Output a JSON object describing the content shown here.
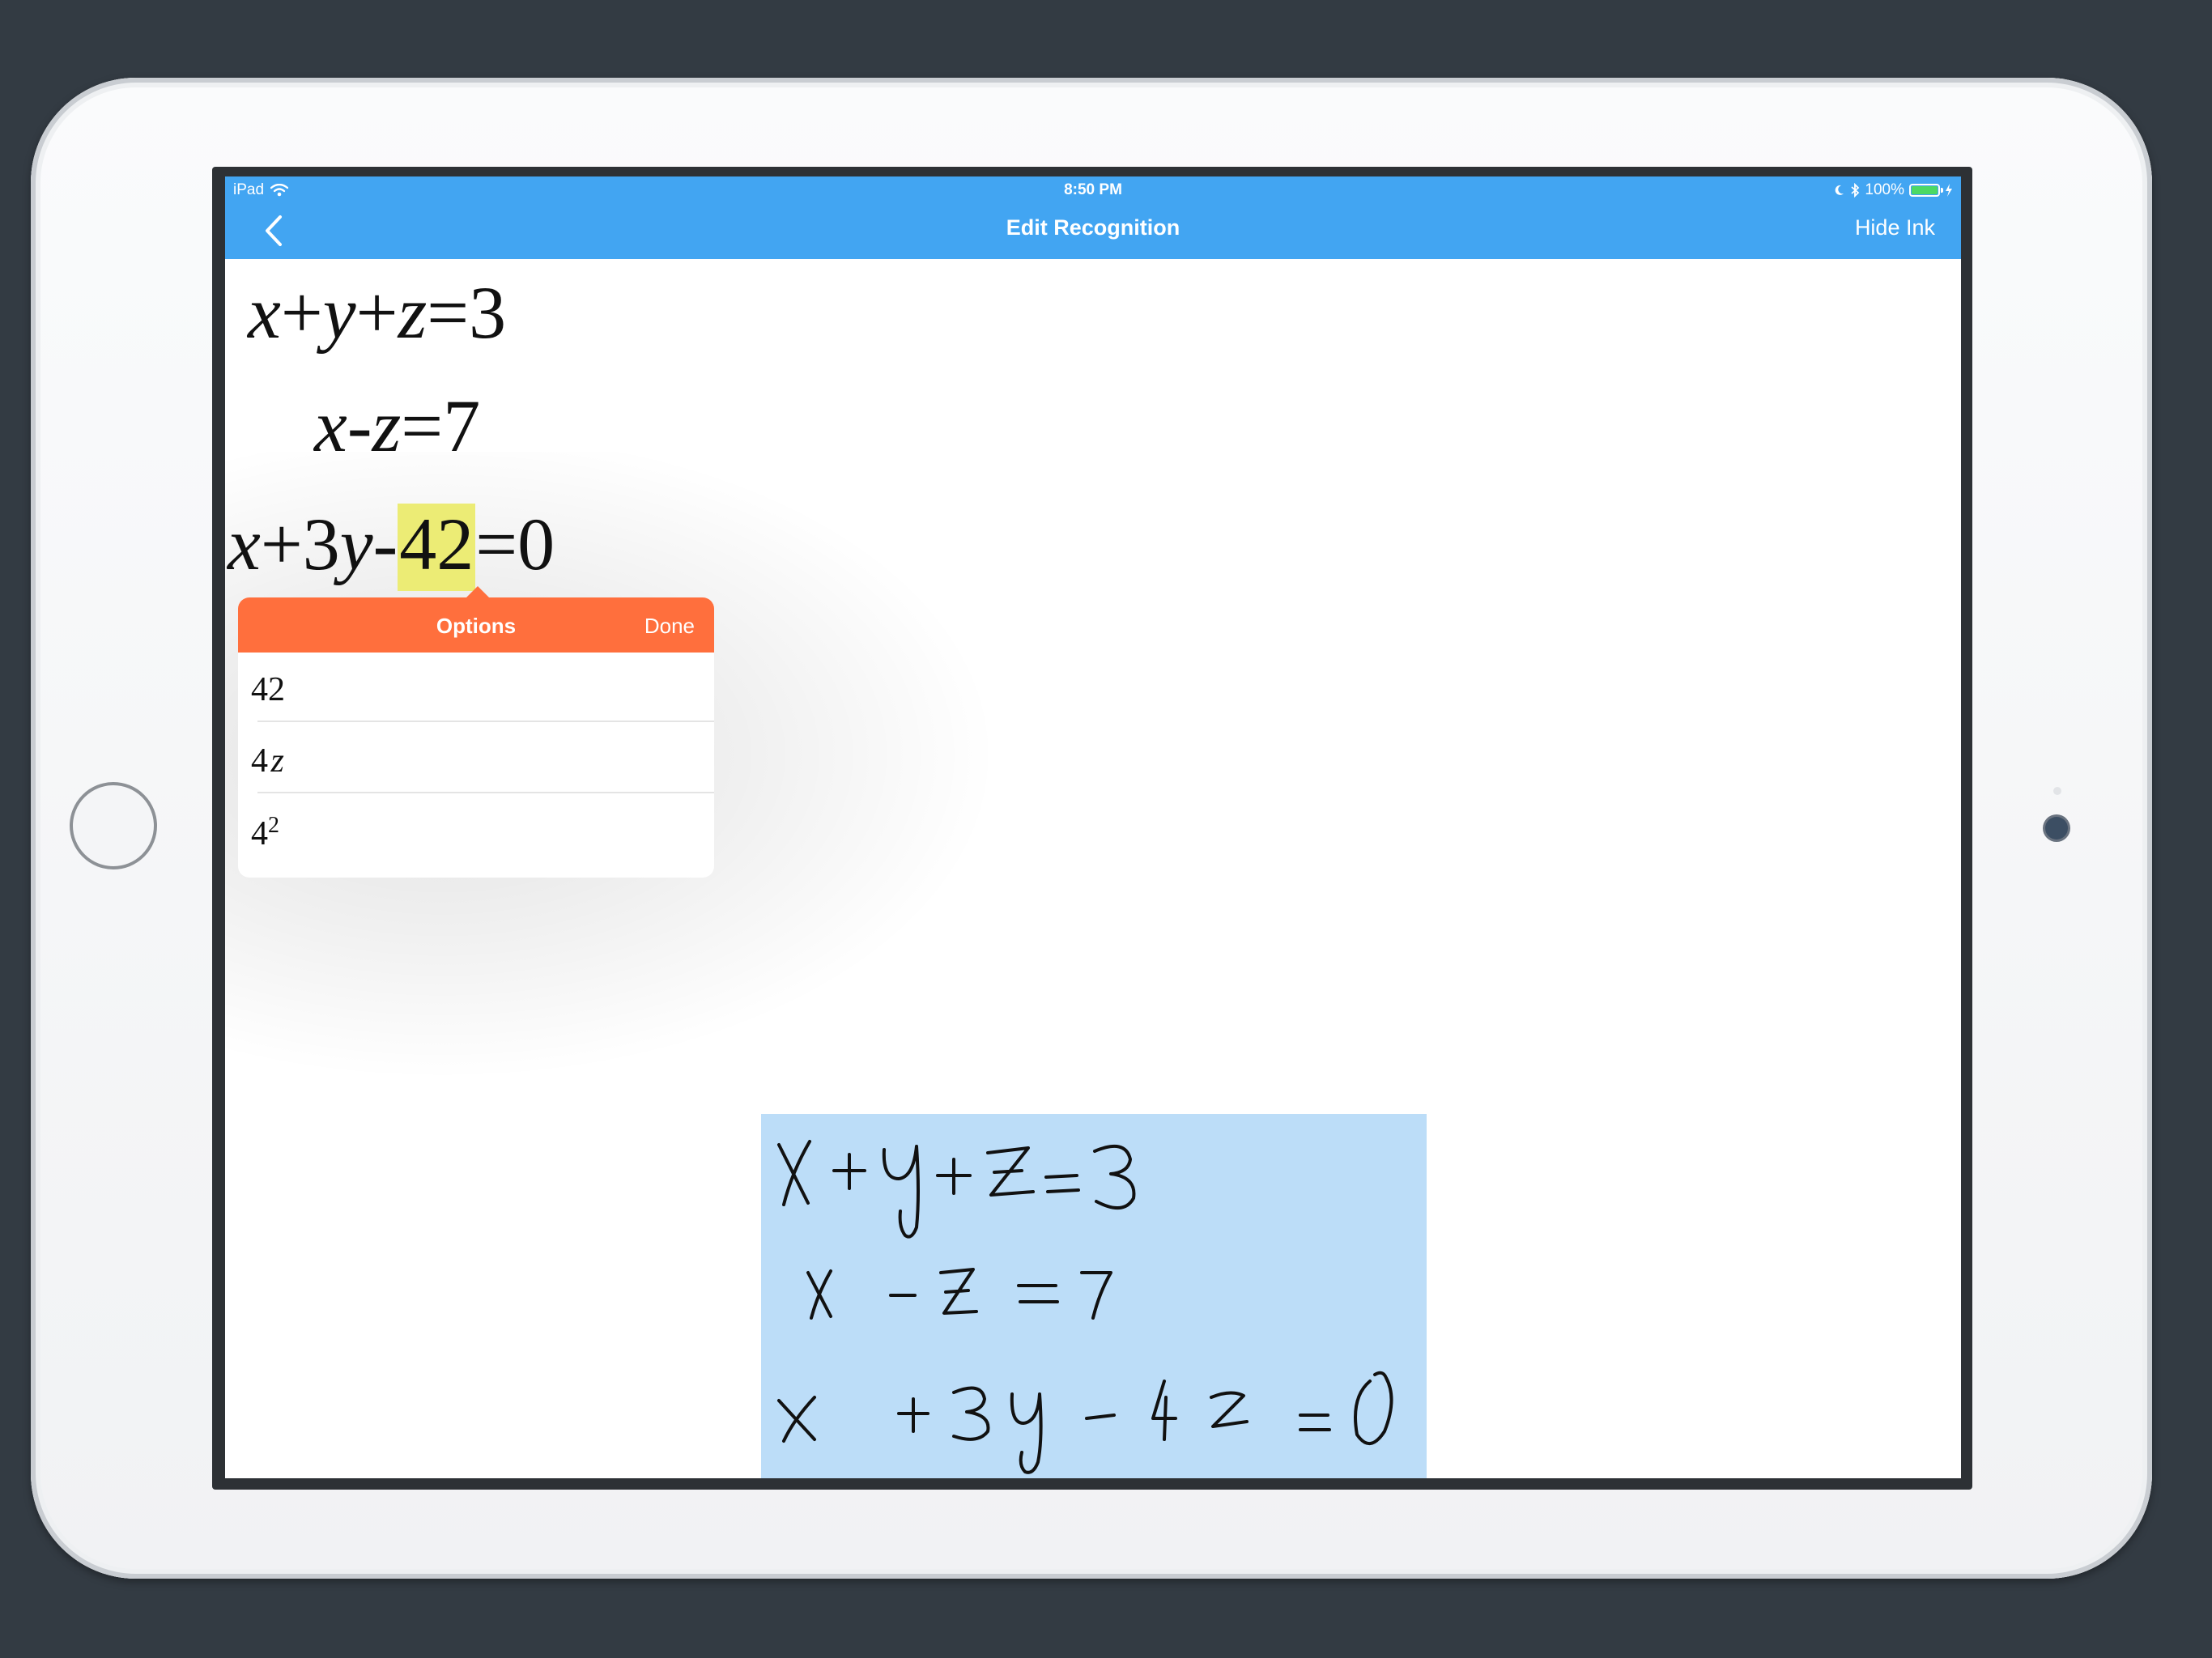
{
  "status_bar": {
    "device": "iPad",
    "time": "8:50 PM",
    "battery": "100%",
    "battery_level": 1.0
  },
  "navbar": {
    "title": "Edit Recognition",
    "hide_ink_label": "Hide Ink"
  },
  "equations": {
    "eq1": {
      "x": "x",
      "p1": "+",
      "y": "y",
      "p2": "+",
      "z": "z",
      "eq": "=",
      "rhs": "3"
    },
    "eq2": {
      "x": "x",
      "m": "-",
      "z": "z",
      "eq": "=",
      "rhs": "7"
    },
    "eq3": {
      "x": "x",
      "p": "+",
      "coef": "3",
      "y": "y",
      "m": "-",
      "selected": "42",
      "eq": "=",
      "rhs": "0"
    }
  },
  "options_popover": {
    "title": "Options",
    "done_label": "Done",
    "options": [
      {
        "base": "42",
        "suffix": "",
        "sup": ""
      },
      {
        "base": "4",
        "suffix": "z",
        "sup": ""
      },
      {
        "base": "4",
        "suffix": "",
        "sup": "2"
      }
    ]
  },
  "colors": {
    "navbar": "#42a5f2",
    "popover_header": "#ff6f3d",
    "highlight": "#ecec75",
    "ink_panel": "#bcddf8"
  }
}
